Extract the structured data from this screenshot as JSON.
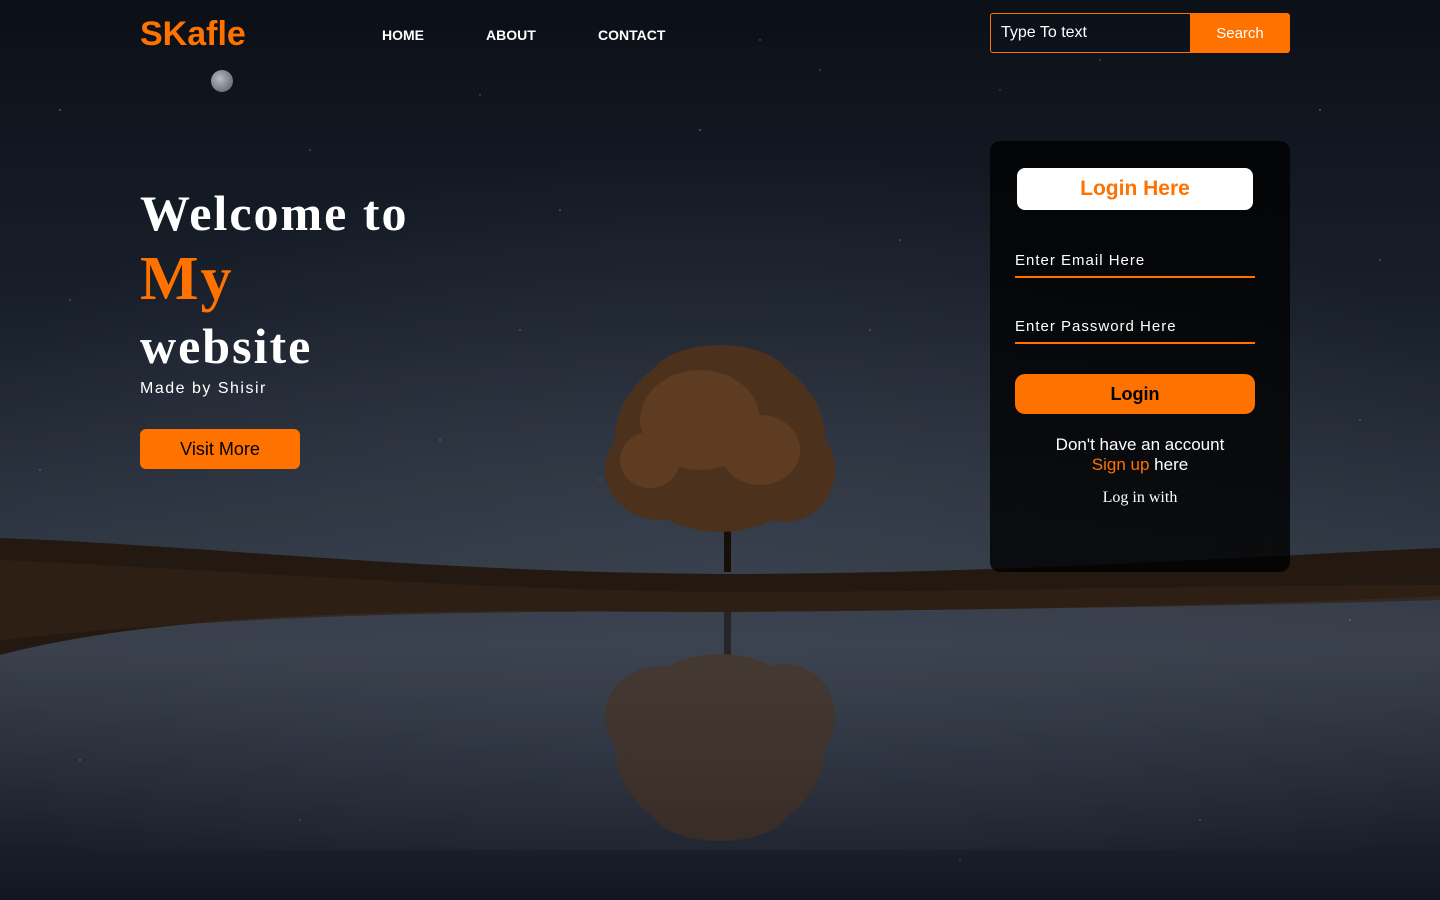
{
  "header": {
    "logo": "SKafle",
    "nav": [
      {
        "label": "HOME"
      },
      {
        "label": "ABOUT"
      },
      {
        "label": "CONTACT"
      }
    ],
    "search": {
      "placeholder": "Type To text",
      "button_label": "Search"
    }
  },
  "hero": {
    "line1": "Welcome to",
    "line2": "My",
    "line3": "website",
    "subtitle": "Made by Shisir",
    "button_label": "Visit More"
  },
  "login": {
    "title": "Login Here",
    "email_placeholder": "Enter Email Here",
    "password_placeholder": "Enter Password Here",
    "button_label": "Login",
    "no_account_text": "Don't have an account",
    "signup_link": "Sign up",
    "signup_suffix": " here",
    "login_with": "Log in with"
  },
  "colors": {
    "accent": "#ff7200",
    "card_bg": "#0d0e10",
    "sky_top": "#0f141d",
    "sky_mid": "#323a48",
    "ground": "#2a1d14"
  }
}
